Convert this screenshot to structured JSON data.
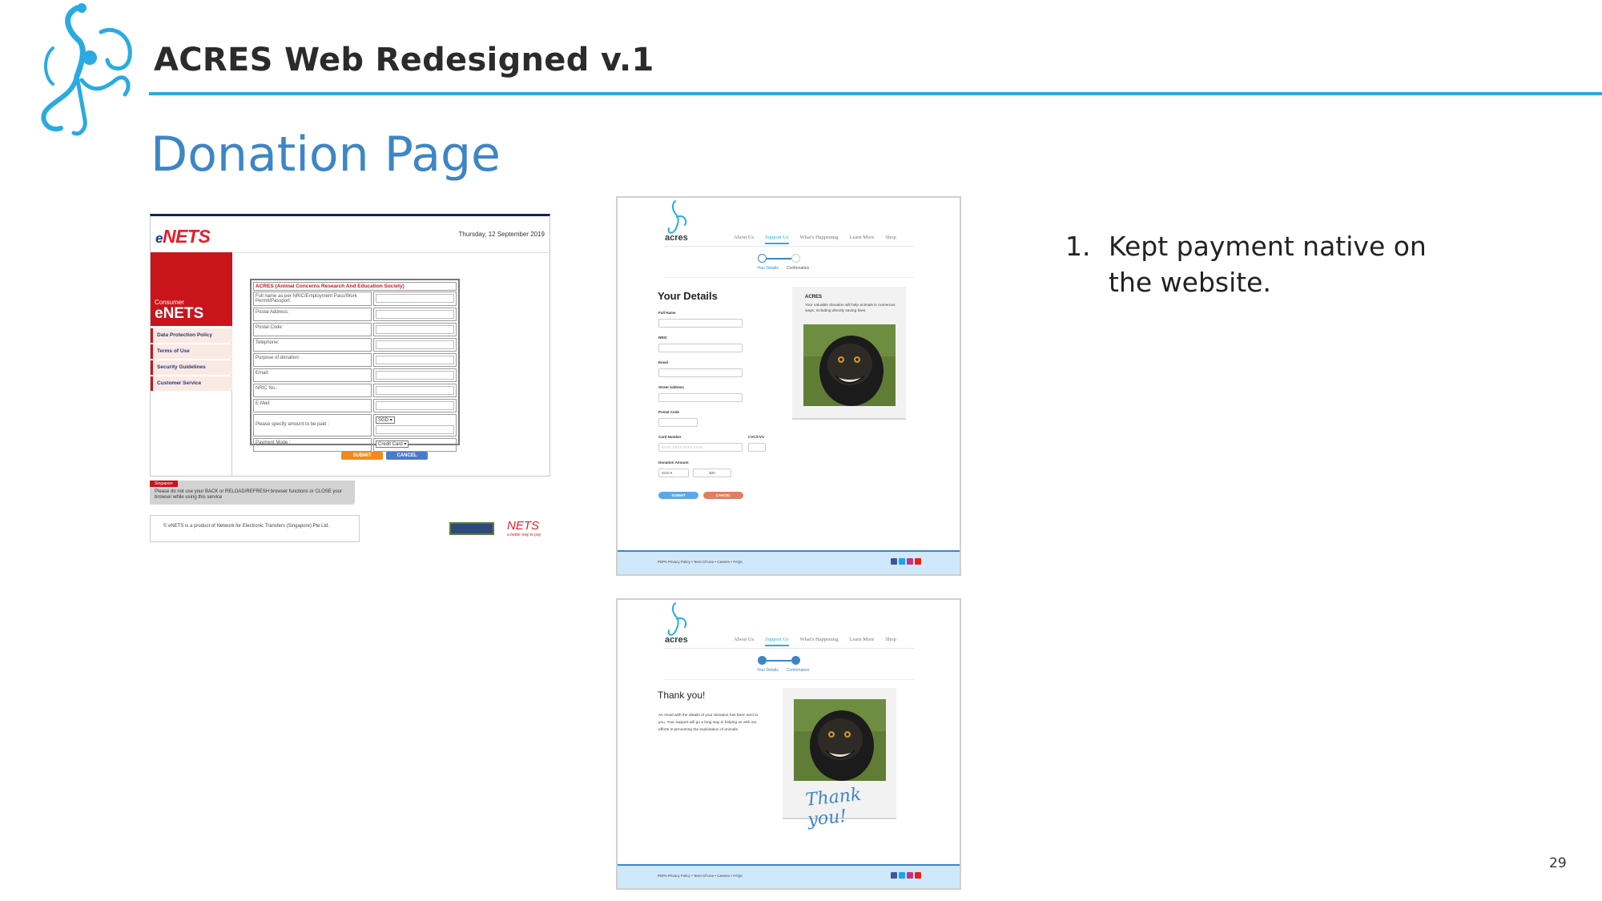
{
  "slide": {
    "title": "ACRES Web Redesigned v.1",
    "heading": "Donation Page",
    "page_number": "29",
    "bullets": [
      {
        "num": "1.",
        "text": "Kept payment native on the website."
      }
    ],
    "accent_color": "#29abe2",
    "heading_color": "#3d86c6"
  },
  "enets": {
    "brand_e": "e",
    "brand": "NETS",
    "date": "Thursday, 12 September 2019",
    "consumer": "Consumer",
    "consumer_brand": "eNETS",
    "nav": [
      "Data Protection Policy",
      "Terms of Use",
      "Security Guidelines",
      "Customer Service"
    ],
    "form_title": "ACRES (Animal Concerns Research And Education Society)",
    "fields": [
      "Full name as per NRIC/Employment Pass/Work Permit/Passport:",
      "Postal Address:",
      "Postal Code:",
      "Telephone:",
      "Purpose of donation:",
      "Email:",
      "NRIC No.:",
      "E-Mail:"
    ],
    "amount_label": "Please specify amount to be paid :",
    "currency": "SGD ▾",
    "payment_label": "Payment Mode :",
    "payment_value": "Credit Card     ▾",
    "submit": "SUBMIT",
    "cancel": "CANCEL",
    "warn_tag": "Singapore",
    "warning": "Please do not use your BACK or RELOAD/REFRESH browser functions or CLOSE your browser while using this service",
    "footer": "© eNETS is a product of Network for Electronic Transfers (Singapore) Pte Ltd.",
    "nets_logo": "NETS",
    "nets_tagline": "a better way to pay",
    "brand_red": "#c9141c"
  },
  "mock1": {
    "logo_text": "acres",
    "nav": [
      "About Us",
      "Support Us",
      "What's Happening",
      "Learn More",
      "Shop"
    ],
    "active_nav": "Support Us",
    "steps": [
      "Your Details",
      "Confirmation"
    ],
    "heading": "Your Details",
    "fields": {
      "full_name": "Full Name",
      "nric": "NRIC",
      "email": "Email",
      "street": "Street Address",
      "postal": "Postal Code",
      "card": "Card Number",
      "card_placeholder": "XXXX XXXX XXXX XXXX",
      "cvc": "CVC/CVV",
      "amount": "Donation Amount",
      "currency": "SGD  ▾",
      "amount_value": "$20"
    },
    "submit": "SUBMIT",
    "cancel": "CANCEL",
    "card_title": "ACRES",
    "card_text": "Your valuable donation will help animals in numerous ways, including directly saving lives.",
    "footer_links": "PDPA Privacy Policy  •  Term Of Use  •  Careers  •  FAQs"
  },
  "mock2": {
    "logo_text": "acres",
    "nav": [
      "About Us",
      "Support Us",
      "What's Happening",
      "Learn More",
      "Shop"
    ],
    "steps": [
      "Your Details",
      "Confirmation"
    ],
    "heading": "Thank you!",
    "text": "An email with the details of your donation has been sent to you. Your support will go a long way in helping us with our efforts in preventing the exploitation of animals.",
    "card_note": "Thank you!",
    "footer_links": "PDPA Privacy Policy  •  Term Of Use  •  Careers  •  FAQs"
  }
}
